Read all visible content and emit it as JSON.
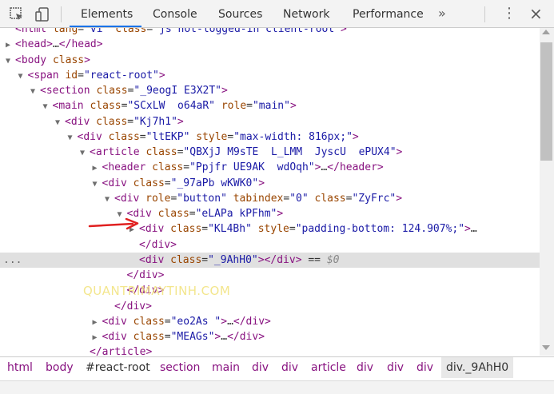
{
  "tabs": [
    "Elements",
    "Console",
    "Sources",
    "Network",
    "Performance"
  ],
  "more_tabs": "»",
  "menu_icon": "⋮",
  "close_icon": "×",
  "tree": [
    {
      "indent": 1,
      "tri": "",
      "parts": [
        [
          "tag",
          "<html "
        ],
        [
          "attr",
          "lang"
        ],
        [
          "eq",
          "="
        ],
        [
          "val",
          "\"vi\""
        ],
        [
          "attr",
          " class"
        ],
        [
          "eq",
          "="
        ],
        [
          "val",
          "\"js not-logged-in client-root\""
        ],
        [
          "tag",
          ">"
        ]
      ]
    },
    {
      "indent": 1,
      "tri": "▶",
      "parts": [
        [
          "tag",
          "<head>"
        ],
        [
          "ell",
          "…"
        ],
        [
          "tag",
          "</head>"
        ]
      ]
    },
    {
      "indent": 1,
      "tri": "▼",
      "parts": [
        [
          "tag",
          "<body "
        ],
        [
          "attr",
          "class"
        ],
        [
          "tag",
          ">"
        ]
      ]
    },
    {
      "indent": 2,
      "tri": "▼",
      "parts": [
        [
          "tag",
          "<span "
        ],
        [
          "attr",
          "id"
        ],
        [
          "eq",
          "="
        ],
        [
          "val",
          "\"react-root\""
        ],
        [
          "tag",
          ">"
        ]
      ]
    },
    {
      "indent": 3,
      "tri": "▼",
      "parts": [
        [
          "tag",
          "<section "
        ],
        [
          "attr",
          "class"
        ],
        [
          "eq",
          "="
        ],
        [
          "val",
          "\"_9eogI E3X2T\""
        ],
        [
          "tag",
          ">"
        ]
      ]
    },
    {
      "indent": 4,
      "tri": "▼",
      "parts": [
        [
          "tag",
          "<main "
        ],
        [
          "attr",
          "class"
        ],
        [
          "eq",
          "="
        ],
        [
          "val",
          "\"SCxLW  o64aR\""
        ],
        [
          "attr",
          " role"
        ],
        [
          "eq",
          "="
        ],
        [
          "val",
          "\"main\""
        ],
        [
          "tag",
          ">"
        ]
      ]
    },
    {
      "indent": 5,
      "tri": "▼",
      "parts": [
        [
          "tag",
          "<div "
        ],
        [
          "attr",
          "class"
        ],
        [
          "eq",
          "="
        ],
        [
          "val",
          "\"Kj7h1\""
        ],
        [
          "tag",
          ">"
        ]
      ]
    },
    {
      "indent": 6,
      "tri": "▼",
      "parts": [
        [
          "tag",
          "<div "
        ],
        [
          "attr",
          "class"
        ],
        [
          "eq",
          "="
        ],
        [
          "val",
          "\"ltEKP\""
        ],
        [
          "attr",
          " style"
        ],
        [
          "eq",
          "="
        ],
        [
          "val",
          "\"max-width: 816px;\""
        ],
        [
          "tag",
          ">"
        ]
      ]
    },
    {
      "indent": 7,
      "tri": "▼",
      "parts": [
        [
          "tag",
          "<article "
        ],
        [
          "attr",
          "class"
        ],
        [
          "eq",
          "="
        ],
        [
          "val",
          "\"QBXjJ M9sTE  L_LMM  JyscU  ePUX4\""
        ],
        [
          "tag",
          ">"
        ]
      ]
    },
    {
      "indent": 8,
      "tri": "▶",
      "parts": [
        [
          "tag",
          "<header "
        ],
        [
          "attr",
          "class"
        ],
        [
          "eq",
          "="
        ],
        [
          "val",
          "\"Ppjfr UE9AK  wdOqh\""
        ],
        [
          "tag",
          ">"
        ],
        [
          "ell",
          "…"
        ],
        [
          "tag",
          "</header>"
        ]
      ]
    },
    {
      "indent": 8,
      "tri": "▼",
      "parts": [
        [
          "tag",
          "<div "
        ],
        [
          "attr",
          "class"
        ],
        [
          "eq",
          "="
        ],
        [
          "val",
          "\"_97aPb wKWK0\""
        ],
        [
          "tag",
          ">"
        ]
      ]
    },
    {
      "indent": 9,
      "tri": "▼",
      "parts": [
        [
          "tag",
          "<div "
        ],
        [
          "attr",
          "role"
        ],
        [
          "eq",
          "="
        ],
        [
          "val",
          "\"button\""
        ],
        [
          "attr",
          " tabindex"
        ],
        [
          "eq",
          "="
        ],
        [
          "val",
          "\"0\""
        ],
        [
          "attr",
          " class"
        ],
        [
          "eq",
          "="
        ],
        [
          "val",
          "\"ZyFrc\""
        ],
        [
          "tag",
          ">"
        ]
      ]
    },
    {
      "indent": 10,
      "tri": "▼",
      "parts": [
        [
          "tag",
          "<div "
        ],
        [
          "attr",
          "class"
        ],
        [
          "eq",
          "="
        ],
        [
          "val",
          "\"eLAPa kPFhm\""
        ],
        [
          "tag",
          ">"
        ]
      ]
    },
    {
      "indent": 11,
      "tri": "▶",
      "parts": [
        [
          "tag",
          "<div "
        ],
        [
          "attr",
          "class"
        ],
        [
          "eq",
          "="
        ],
        [
          "val",
          "\"KL4Bh\""
        ],
        [
          "attr",
          " style"
        ],
        [
          "eq",
          "="
        ],
        [
          "val",
          "\"padding-bottom: 124.907%;\""
        ],
        [
          "tag",
          ">"
        ],
        [
          "ell",
          "…"
        ]
      ]
    },
    {
      "indent": 11,
      "tri": "",
      "parts": [
        [
          "tag",
          "</div>"
        ]
      ]
    },
    {
      "indent": 11,
      "tri": "",
      "selected": true,
      "parts": [
        [
          "tag",
          "<div "
        ],
        [
          "attr",
          "class"
        ],
        [
          "eq",
          "="
        ],
        [
          "val",
          "\"_9AhH0\""
        ],
        [
          "tag",
          "></div>"
        ],
        [
          "eq",
          " == "
        ],
        [
          "dollar",
          "$0"
        ]
      ]
    },
    {
      "indent": 10,
      "tri": "",
      "parts": [
        [
          "tag",
          "</div>"
        ]
      ]
    },
    {
      "indent": 10,
      "tri": "",
      "parts": [
        [
          "tag",
          "</div>"
        ]
      ]
    },
    {
      "indent": 9,
      "tri": "",
      "parts": [
        [
          "tag",
          "</div>"
        ]
      ]
    },
    {
      "indent": 8,
      "tri": "▶",
      "parts": [
        [
          "tag",
          "<div "
        ],
        [
          "attr",
          "class"
        ],
        [
          "eq",
          "="
        ],
        [
          "val",
          "\"eo2As \""
        ],
        [
          "tag",
          ">"
        ],
        [
          "ell",
          "…"
        ],
        [
          "tag",
          "</div>"
        ]
      ]
    },
    {
      "indent": 8,
      "tri": "▶",
      "parts": [
        [
          "tag",
          "<div "
        ],
        [
          "attr",
          "class"
        ],
        [
          "eq",
          "="
        ],
        [
          "val",
          "\"MEAGs\""
        ],
        [
          "tag",
          ">"
        ],
        [
          "ell",
          "…"
        ],
        [
          "tag",
          "</div>"
        ]
      ]
    },
    {
      "indent": 7,
      "tri": "",
      "parts": [
        [
          "tag",
          "</article>"
        ]
      ]
    }
  ],
  "selected_dots": "...",
  "breadcrumb": [
    "html",
    "body",
    "#react-root",
    "section",
    "main",
    "div",
    "div",
    "article",
    "div",
    "div",
    "div",
    "div._9AhH0"
  ],
  "watermark": "QUANTRIMAYTINH.COM",
  "colors": {
    "tag": "#881280",
    "attr": "#994500",
    "value": "#1a1aa6",
    "accent": "#1a73e8",
    "arrow": "#e02020"
  }
}
